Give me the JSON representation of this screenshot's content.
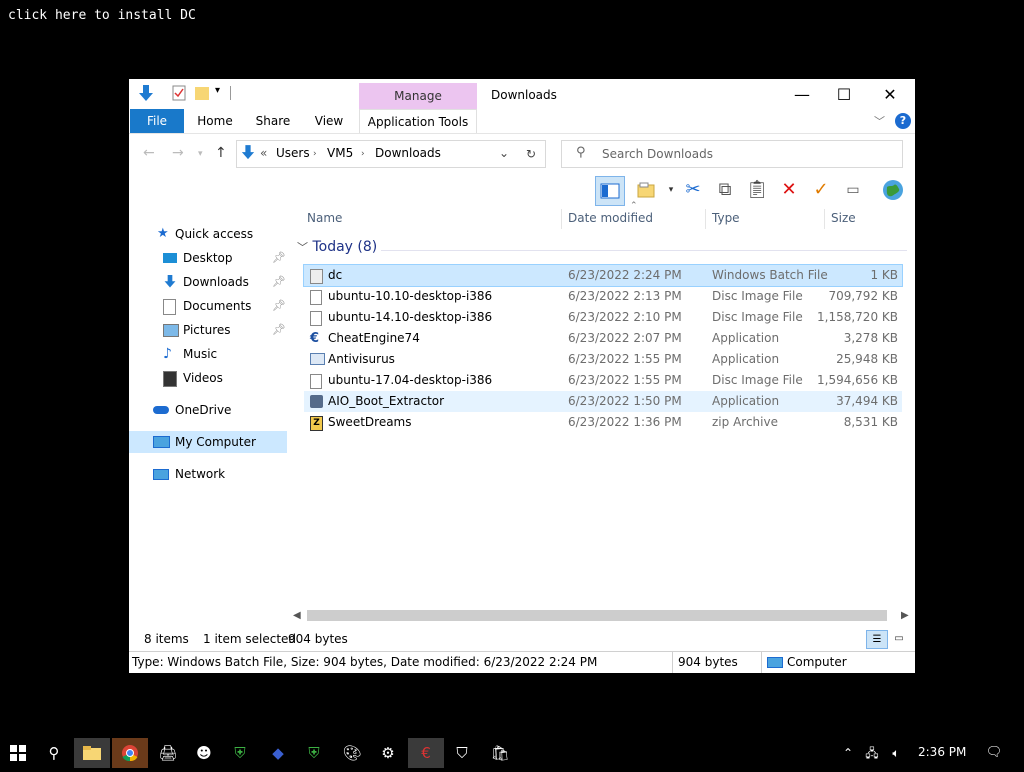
{
  "desktop": {
    "hint": "click here to install DC"
  },
  "window": {
    "title": "Downloads",
    "manage_label": "Manage",
    "tabs": [
      "File",
      "Home",
      "Share",
      "View",
      "Application Tools"
    ],
    "controls": {
      "minimize": "—",
      "maximize": "☐",
      "close": "✕"
    },
    "help": "?"
  },
  "nav": {
    "breadcrumb": [
      "«",
      "Users",
      "VM5",
      "Downloads"
    ],
    "search_placeholder": "Search Downloads"
  },
  "sidebar": {
    "quick_access": "Quick access",
    "items": [
      {
        "label": "Desktop",
        "icon": "desktop-icon",
        "pinned": true
      },
      {
        "label": "Downloads",
        "icon": "download-arrow-icon",
        "pinned": true
      },
      {
        "label": "Documents",
        "icon": "document-icon",
        "pinned": true
      },
      {
        "label": "Pictures",
        "icon": "pictures-icon",
        "pinned": true
      },
      {
        "label": "Music",
        "icon": "music-note-icon",
        "pinned": false
      },
      {
        "label": "Videos",
        "icon": "film-icon",
        "pinned": false
      }
    ],
    "onedrive": "OneDrive",
    "my_computer": "My Computer",
    "network": "Network"
  },
  "columns": [
    "Name",
    "Date modified",
    "Type",
    "Size"
  ],
  "group": {
    "label": "Today (8)"
  },
  "files": [
    {
      "name": "dc",
      "date": "6/23/2022 2:24 PM",
      "type": "Windows Batch File",
      "size": "1 KB",
      "icon": "batch-file-icon",
      "selected": true
    },
    {
      "name": "ubuntu-10.10-desktop-i386",
      "date": "6/23/2022 2:13 PM",
      "type": "Disc Image File",
      "size": "709,792 KB",
      "icon": "disc-image-icon"
    },
    {
      "name": "ubuntu-14.10-desktop-i386",
      "date": "6/23/2022 2:10 PM",
      "type": "Disc Image File",
      "size": "1,158,720 KB",
      "icon": "disc-image-icon"
    },
    {
      "name": "CheatEngine74",
      "date": "6/23/2022 2:07 PM",
      "type": "Application",
      "size": "3,278 KB",
      "icon": "cheatengine-icon"
    },
    {
      "name": "Antivisurus",
      "date": "6/23/2022 1:55 PM",
      "type": "Application",
      "size": "25,948 KB",
      "icon": "application-icon"
    },
    {
      "name": "ubuntu-17.04-desktop-i386",
      "date": "6/23/2022 1:55 PM",
      "type": "Disc Image File",
      "size": "1,594,656 KB",
      "icon": "disc-image-icon"
    },
    {
      "name": "AIO_Boot_Extractor",
      "date": "6/23/2022 1:50 PM",
      "type": "Application",
      "size": "37,494 KB",
      "icon": "aio-boot-icon",
      "hover": true
    },
    {
      "name": "SweetDreams",
      "date": "6/23/2022 1:36 PM",
      "type": "zip Archive",
      "size": "8,531 KB",
      "icon": "zip-archive-icon"
    }
  ],
  "status": {
    "count": "8 items",
    "selected": "1 item selected",
    "bytes": "904 bytes"
  },
  "infobar": {
    "details": "Type: Windows Batch File, Size: 904 bytes, Date modified: 6/23/2022 2:24 PM",
    "size": "904 bytes",
    "location": "Computer"
  },
  "taskbar": {
    "time": "2:36 PM"
  }
}
